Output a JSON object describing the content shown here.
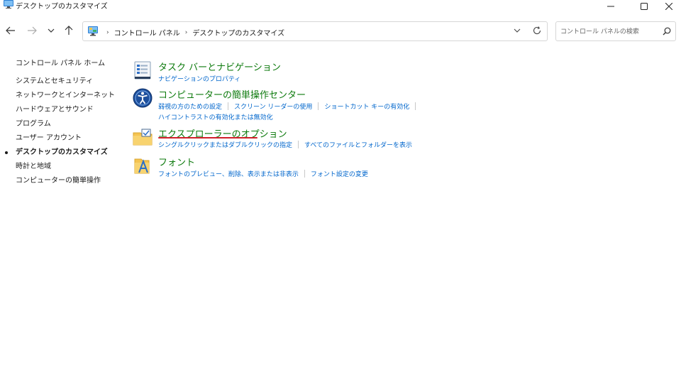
{
  "window": {
    "title": "デスクトップのカスタマイズ"
  },
  "address": {
    "crumbs": [
      "コントロール パネル",
      "デスクトップのカスタマイズ"
    ]
  },
  "search": {
    "placeholder": "コントロール パネルの検索"
  },
  "sidebar": {
    "home": "コントロール パネル ホーム",
    "items": [
      {
        "label": "システムとセキュリティ"
      },
      {
        "label": "ネットワークとインターネット"
      },
      {
        "label": "ハードウェアとサウンド"
      },
      {
        "label": "プログラム"
      },
      {
        "label": "ユーザー アカウント"
      },
      {
        "label": "デスクトップのカスタマイズ",
        "active": true
      },
      {
        "label": "時計と地域"
      },
      {
        "label": "コンピューターの簡単操作"
      }
    ]
  },
  "categories": [
    {
      "title": "タスク バーとナビゲーション",
      "icon": "taskbar-icon",
      "links": [
        [
          "ナビゲーションのプロパティ"
        ]
      ]
    },
    {
      "title": "コンピューターの簡単操作センター",
      "icon": "ease-of-access-icon",
      "links": [
        [
          "弱視の方のための設定",
          "スクリーン リーダーの使用",
          "ショートカット キーの有効化"
        ],
        [
          "ハイコントラストの有効化または無効化"
        ]
      ]
    },
    {
      "title": "エクスプローラーのオプション",
      "icon": "folder-options-icon",
      "links": [
        [
          "シングルクリックまたはダブルクリックの指定",
          "すべてのファイルとフォルダーを表示"
        ]
      ]
    },
    {
      "title": "フォント",
      "icon": "fonts-icon",
      "links": [
        [
          "フォントのプレビュー、削除、表示または非表示",
          "フォント設定の変更"
        ]
      ]
    }
  ],
  "colors": {
    "category_title": "#0d7a0d",
    "link": "#0066cc",
    "annotation_underline": "#d0202a"
  }
}
